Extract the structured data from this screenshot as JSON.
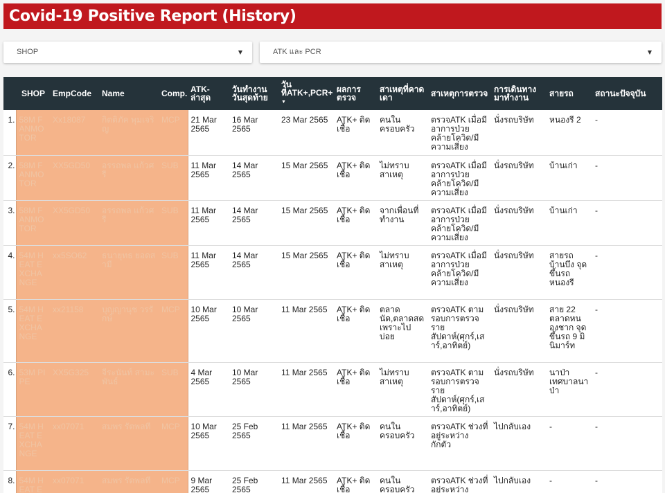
{
  "title": "Covid-19 Positive Report (History)",
  "filters": {
    "shop": "SHOP",
    "test_type": "ATK และ PCR"
  },
  "columns": {
    "shop": "SHOP",
    "empcode": "EmpCode",
    "name": "Name",
    "comp": "Comp.",
    "atk_last": "ATK-ล่าสุด",
    "last_work": "วันทำงานวันสุดท้าย",
    "date_pos": "วันที่ATK+,PCR+",
    "result": "ผลการตรวจ",
    "suspected": "สาเหตุที่คาดเดา",
    "reason": "สาเหตุการตรวจ",
    "travel": "การเดินทางมาทำงาน",
    "route": "สายรถ",
    "status": "สถานะปัจจุบัน"
  },
  "rows": [
    {
      "idx": "1.",
      "shop": "58M FANMOTOR",
      "emp": "Xx18087",
      "name": "กิตติภัค พุมเจริญ",
      "comp": "MCP",
      "atk": "21 Mar 2565",
      "last": "16 Mar 2565",
      "pos": "23 Mar 2565",
      "result": "ATK+ ติดเชื้อ",
      "suspected": "คนในครอบครัว",
      "reason": "ตรวจATK เมื่อมีอาการป่วยคล้ายโควิด/มีความเสี่ยง",
      "travel": "นั่งรถบริษัท",
      "route": "หนองรี 2",
      "status": "-"
    },
    {
      "idx": "2.",
      "shop": "58M FANMOTOR",
      "emp": "XX5GD50",
      "name": "อรรถพล แก้วศรี",
      "comp": "SUB",
      "atk": "11 Mar 2565",
      "last": "14 Mar 2565",
      "pos": "15 Mar 2565",
      "result": "ATK+ ติดเชื้อ",
      "suspected": "ไม่ทราบสาเหตุ",
      "reason": "ตรวจATK เมื่อมีอาการป่วยคล้ายโควิด/มีความเสี่ยง",
      "travel": "นั่งรถบริษัท",
      "route": "บ้านเก่า",
      "status": "-"
    },
    {
      "idx": "3.",
      "shop": "58M FANMOTOR",
      "emp": "XX5GD50",
      "name": "อรรถพล แก้วศรี",
      "comp": "SUB",
      "atk": "11 Mar 2565",
      "last": "14 Mar 2565",
      "pos": "15 Mar 2565",
      "result": "ATK+ ติดเชื้อ",
      "suspected": "จากเพื่อนที่ทำงาน",
      "reason": "ตรวจATK เมื่อมีอาการป่วยคล้ายโควิด/มีความเสี่ยง",
      "travel": "นั่งรถบริษัท",
      "route": "บ้านเก่า",
      "status": "-"
    },
    {
      "idx": "4.",
      "shop": "54M HEAT EXCHANGE",
      "emp": "xx5SO62",
      "name": "ธนายุทธ ยอดสามี",
      "comp": "SUB",
      "atk": "11 Mar 2565",
      "last": "14 Mar 2565",
      "pos": "15 Mar 2565",
      "result": "ATK+ ติดเชื้อ",
      "suspected": "ไม่ทราบสาเหตุ",
      "reason": "ตรวจATK เมื่อมีอาการป่วยคล้ายโควิด/มีความเสี่ยง",
      "travel": "นั่งรถบริษัท",
      "route": "สายรถบ้านบึง จุดขึ้นรถหนองรี",
      "status": "-"
    },
    {
      "idx": "5.",
      "shop": "54M HEAT EXCHANGE",
      "emp": "xx21158",
      "name": "บุญญานุช วรรักษ์",
      "comp": "MCP",
      "atk": "10 Mar 2565",
      "last": "10 Mar 2565",
      "pos": "11 Mar 2565",
      "result": "ATK+ ติดเชื้อ",
      "suspected": "ตลาดนัด,ตลาดสด เพราะไปบ่อย",
      "reason": "ตรวจATK ตามรอบการตรวจราย สัปดาห์(ศุกร์,เสาร์,อาทิตย์)",
      "travel": "นั่งรถบริษัท",
      "route": "สาย 22 ตลาดหนองชาก จุดขึ้นรถ 9 มินิมาร์ท",
      "status": "-"
    },
    {
      "idx": "6.",
      "shop": "53M PIPE",
      "emp": "XX5G325",
      "name": "จีระนันท์ สามะพันธ์",
      "comp": "SUB",
      "atk": "4 Mar 2565",
      "last": "10 Mar 2565",
      "pos": "11 Mar 2565",
      "result": "ATK+ ติดเชื้อ",
      "suspected": "ไม่ทราบสาเหตุ",
      "reason": "ตรวจATK ตามรอบการตรวจราย สัปดาห์(ศุกร์,เสาร์,อาทิตย์)",
      "travel": "นั่งรถบริษัท",
      "route": "นาป่า เทศบาลนาป่า",
      "status": "-"
    },
    {
      "idx": "7.",
      "shop": "54M HEAT EXCHANGE",
      "emp": "xx07071",
      "name": "สมพร รัตพลที",
      "comp": "MCP",
      "atk": "10 Mar 2565",
      "last": "25 Feb 2565",
      "pos": "11 Mar 2565",
      "result": "ATK+ ติดเชื้อ",
      "suspected": "คนในครอบครัว",
      "reason": "ตรวจATK ช่วงที่อยู่ระหว่างกักตัว",
      "travel": "ไปกลับเอง",
      "route": "-",
      "status": "-"
    },
    {
      "idx": "8.",
      "shop": "54M HEAT EXCHANGE",
      "emp": "xx07071",
      "name": "สมพร รัตพลที",
      "comp": "MCP",
      "atk": "9 Mar 2565",
      "last": "25 Feb 2565",
      "pos": "11 Mar 2565",
      "result": "ATK+ ติดเชื้อ",
      "suspected": "คนในครอบครัว",
      "reason": "ตรวจATK ช่วงที่อยู่ระหว่างกักตัว",
      "travel": "ไปกลับเอง",
      "route": "-",
      "status": "-"
    }
  ]
}
